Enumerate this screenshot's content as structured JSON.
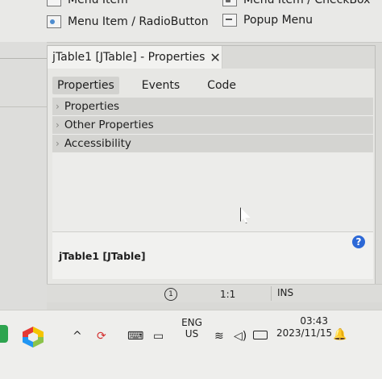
{
  "palette": {
    "items": [
      {
        "label": "Menu Item"
      },
      {
        "label": "Menu Item / CheckBox"
      },
      {
        "label": "Menu Item / RadioButton"
      },
      {
        "label": "Popup Menu"
      }
    ]
  },
  "properties_window": {
    "title": "jTable1 [JTable] - Properties",
    "close_glyph": "✕",
    "tabs": [
      {
        "label": "Properties",
        "active": true
      },
      {
        "label": "Events"
      },
      {
        "label": "Code"
      }
    ],
    "sections": [
      {
        "label": "Properties"
      },
      {
        "label": "Other Properties"
      },
      {
        "label": "Accessibility"
      }
    ],
    "help": {
      "title": "jTable1 [JTable]",
      "icon_glyph": "?"
    }
  },
  "status_bar": {
    "notification_count": "1",
    "caret_position": "1:1",
    "insert_mode": "INS"
  },
  "taskbar": {
    "language_line1": "ENG",
    "language_line2": "US",
    "time": "03:43",
    "date": "2023/11/15",
    "icons": {
      "chevron": "^",
      "record": "⟳",
      "keyboard": "⌨",
      "pen": "▭",
      "wifi": "≋",
      "volume": "◁)",
      "bell": "🔔"
    }
  }
}
